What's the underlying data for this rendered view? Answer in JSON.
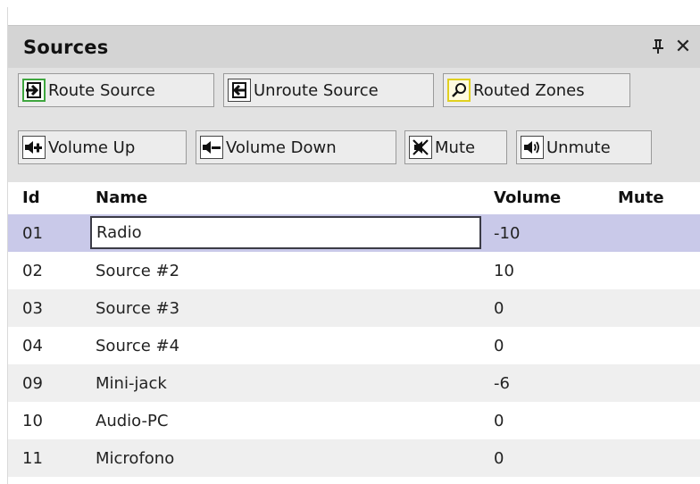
{
  "panel": {
    "title": "Sources"
  },
  "toolbar": {
    "route_source": "Route Source",
    "unroute_source": "Unroute Source",
    "routed_zones": "Routed Zones",
    "volume_up": "Volume Up",
    "volume_down": "Volume Down",
    "mute": "Mute",
    "unmute": "Unmute"
  },
  "icons": {
    "pin": "pin-icon",
    "close": "close-icon",
    "route_source": "arrow-into-box-icon",
    "unroute_source": "arrow-out-of-box-icon",
    "routed_zones": "magnifier-icon",
    "volume_up": "speaker-plus-icon",
    "volume_down": "speaker-minus-icon",
    "mute": "speaker-muted-icon",
    "unmute": "speaker-sound-icon"
  },
  "colors": {
    "title_bar": "#d4d4d4",
    "toolbar": "#e2e2e2",
    "selected_row": "#c9c9e9",
    "alt_row": "#efefef",
    "route_icon": "#3fa63f",
    "routed_zones_icon": "#e0d020"
  },
  "grid": {
    "columns": {
      "id": "Id",
      "name": "Name",
      "volume": "Volume",
      "mute": "Mute"
    },
    "rows": [
      {
        "id": "01",
        "name": "Radio",
        "volume": "-10",
        "mute": ""
      },
      {
        "id": "02",
        "name": "Source #2",
        "volume": "10",
        "mute": ""
      },
      {
        "id": "03",
        "name": "Source #3",
        "volume": "0",
        "mute": ""
      },
      {
        "id": "04",
        "name": "Source #4",
        "volume": "0",
        "mute": ""
      },
      {
        "id": "09",
        "name": "Mini-jack",
        "volume": "-6",
        "mute": ""
      },
      {
        "id": "10",
        "name": "Audio-PC",
        "volume": "0",
        "mute": ""
      },
      {
        "id": "11",
        "name": "Microfono",
        "volume": "0",
        "mute": ""
      }
    ],
    "selected_index": 0
  }
}
